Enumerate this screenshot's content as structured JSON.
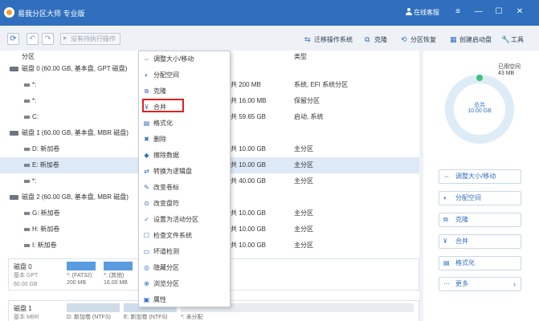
{
  "window": {
    "title": "易我分区大师 专业版",
    "user_status": "在线客服",
    "controls": [
      "≡",
      "—",
      "☐",
      "✕"
    ]
  },
  "toolbar": {
    "refresh": "⟳",
    "undo": "↶",
    "redo": "↷",
    "pending_label": "没有待执行操作",
    "migrate_os": "迁移操作系统",
    "clone": "克隆",
    "partition_recovery": "分区恢复",
    "create_boot_disk": "创建启动盘",
    "tools": "工具"
  },
  "table": {
    "headers": {
      "partition": "分区",
      "type": "类型"
    },
    "rows": [
      {
        "kind": "disk",
        "name": "磁盘 0 (60.00 GB, 基本盘, GPT 磁盘)"
      },
      {
        "kind": "part",
        "name": "*:",
        "total": "共 200 MB",
        "type": "系统, EFI 系统分区"
      },
      {
        "kind": "part",
        "name": "*:",
        "total": "共 16.00 MB",
        "type": "保留分区"
      },
      {
        "kind": "part",
        "name": "C:",
        "total": "共 59.65 GB",
        "type": "启动, 系统"
      },
      {
        "kind": "disk",
        "name": "磁盘 1 (60.00 GB, 基本盘, MBR 磁盘)"
      },
      {
        "kind": "part",
        "name": "D: 新加卷",
        "total": "共 10.00 GB",
        "type": "主分区"
      },
      {
        "kind": "part",
        "name": "E: 新加卷",
        "total": "共 10.00 GB",
        "type": "主分区",
        "selected": true
      },
      {
        "kind": "part",
        "name": "*:",
        "total": "共 40.00 GB",
        "type": "主分区"
      },
      {
        "kind": "disk",
        "name": "磁盘 2 (60.00 GB, 基本盘, MBR 磁盘)"
      },
      {
        "kind": "part",
        "name": "G: 新加卷",
        "total": "共 10.00 GB",
        "type": "主分区"
      },
      {
        "kind": "part",
        "name": "H: 新加卷",
        "total": "共 10.00 GB",
        "type": "主分区"
      },
      {
        "kind": "part",
        "name": "I: 新加卷",
        "total": "共 10.00 GB",
        "type": "主分区"
      }
    ]
  },
  "context_menu": {
    "items": [
      {
        "icon": "⇔",
        "label": "调整大小/移动"
      },
      {
        "icon": "◐",
        "label": "分配空间"
      },
      {
        "icon": "⧉",
        "label": "克隆"
      },
      {
        "icon": "¥",
        "label": "合并"
      },
      {
        "icon": "▤",
        "label": "格式化"
      },
      {
        "icon": "✖",
        "label": "删除"
      },
      {
        "icon": "◆",
        "label": "擦除数据"
      },
      {
        "icon": "⇄",
        "label": "转换为逻辑盘"
      },
      {
        "icon": "✎",
        "label": "改变卷标"
      },
      {
        "icon": "⊙",
        "label": "改变盘符"
      },
      {
        "icon": "✓",
        "label": "设置为活动分区"
      },
      {
        "icon": "☐",
        "label": "检查文件系统"
      },
      {
        "icon": "▭",
        "label": "坏道检测"
      },
      {
        "icon": "◎",
        "label": "隐藏分区"
      },
      {
        "icon": "⊕",
        "label": "浏览分区"
      },
      {
        "icon": "▣",
        "label": "属性"
      }
    ]
  },
  "diskmap": {
    "disk0": {
      "name": "磁盘 0",
      "sub1": "基本 GPT",
      "sub2": "60.00 GB",
      "p1_label": "*: (FAT32)",
      "p1_size": "200 MB",
      "p2_label": "*: (其他)",
      "p2_size": "16.00 MB"
    },
    "disk1": {
      "name": "磁盘 1",
      "sub1": "基本 MBR",
      "p1_label": "D: 新加卷 (NTFS)",
      "p2_label": "E: 新加卷 (NTFS)",
      "p3_label": "*: 未分配"
    }
  },
  "right_panel": {
    "used_label": "已用空间",
    "used_value": "43 MB",
    "total_label": "总共",
    "total_value": "10.00 GB",
    "used_fraction": 0.004,
    "actions": [
      {
        "icon": "⇔",
        "label": "调整大小/移动"
      },
      {
        "icon": "◐",
        "label": "分配空间"
      },
      {
        "icon": "⧉",
        "label": "克隆"
      },
      {
        "icon": "¥",
        "label": "合并"
      },
      {
        "icon": "▤",
        "label": "格式化"
      },
      {
        "icon": "⋯",
        "label": "更多",
        "chevron": "›"
      }
    ]
  }
}
